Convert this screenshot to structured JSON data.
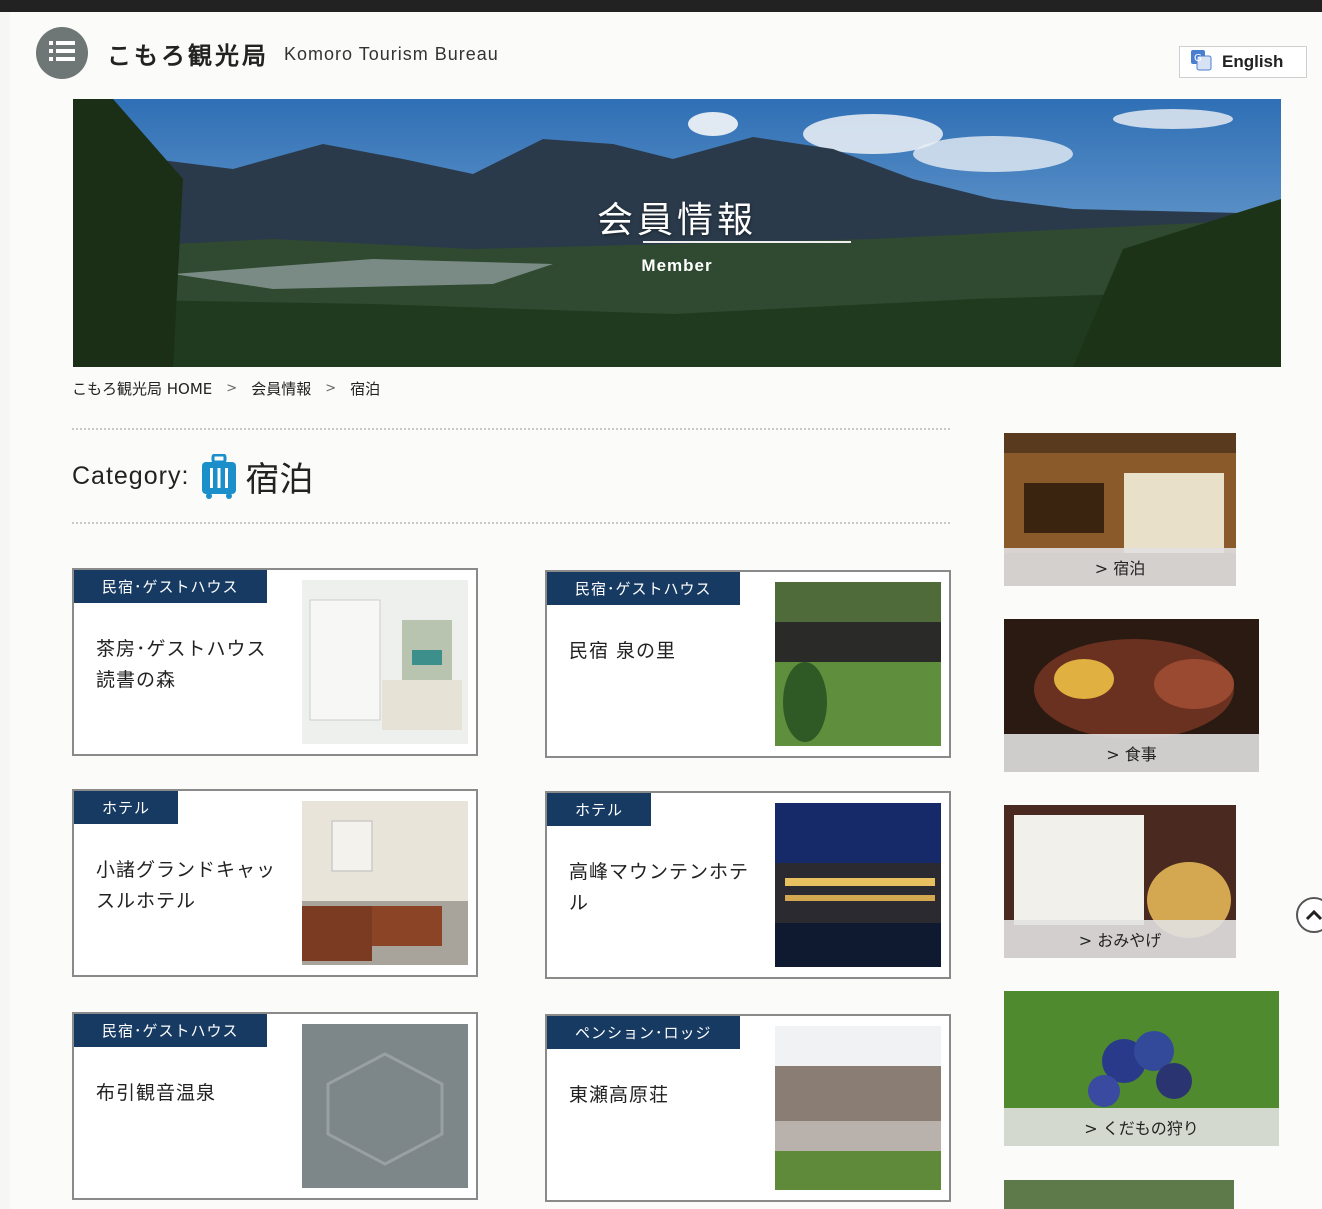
{
  "header": {
    "site_title": "こもろ観光局",
    "site_subtitle": "Komoro Tourism Bureau",
    "language_button": "English",
    "menu_icon": "menu-icon"
  },
  "hero": {
    "title": "会員情報",
    "subtitle": "Member"
  },
  "breadcrumb": {
    "home": "こもろ観光局 HOME",
    "sep1": ">",
    "members": "会員情報",
    "sep2": ">",
    "current": "宿泊"
  },
  "category": {
    "label": "Category:",
    "name": "宿泊",
    "icon": "suitcase-icon",
    "icon_color": "#1a8fc9"
  },
  "cards": [
    {
      "tag": "民宿･ゲストハウス",
      "name": "茶房･ゲストハウス 読書の森"
    },
    {
      "tag": "民宿･ゲストハウス",
      "name": "民宿 泉の里"
    },
    {
      "tag": "ホテル",
      "name": "小諸グランドキャッスルホテル"
    },
    {
      "tag": "ホテル",
      "name": "高峰マウンテンホテル"
    },
    {
      "tag": "民宿･ゲストハウス",
      "name": "布引観音温泉"
    },
    {
      "tag": "ペンション･ロッジ",
      "name": "東瀬高原荘"
    }
  ],
  "sidebar": [
    {
      "label": "> 宿泊"
    },
    {
      "label": "> 食事"
    },
    {
      "label": "> おみやげ"
    },
    {
      "label": "> くだもの狩り"
    }
  ],
  "colors": {
    "tag_bg": "#173a63",
    "accent": "#1a8fc9"
  }
}
